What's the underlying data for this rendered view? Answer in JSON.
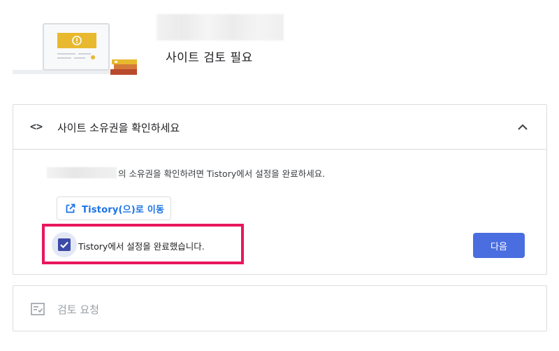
{
  "header": {
    "page_title": "사이트 검토 필요"
  },
  "ownership_card": {
    "title": "사이트 소유권을 확인하세요",
    "instruction": "의 소유권을 확인하려면 Tistory에서 설정을 완료하세요.",
    "open_button_label": "Tistory(으)로 이동",
    "checkbox_label": "Tistory에서 설정을 완료했습니다.",
    "checkbox_checked": true,
    "next_button_label": "다음"
  },
  "review_card": {
    "title": "검토 요청"
  },
  "colors": {
    "accent_blue": "#1a73e8",
    "next_button": "#4a6ee0",
    "checkbox": "#3c4aa8",
    "highlight_box": "#e8175d",
    "illustration_yellow": "#e8b92f"
  },
  "icons": {
    "ownership": "code-icon",
    "collapse": "chevron-up-icon",
    "open_link": "open-in-new-icon",
    "checkbox": "checkmark-icon",
    "review": "review-list-icon"
  }
}
